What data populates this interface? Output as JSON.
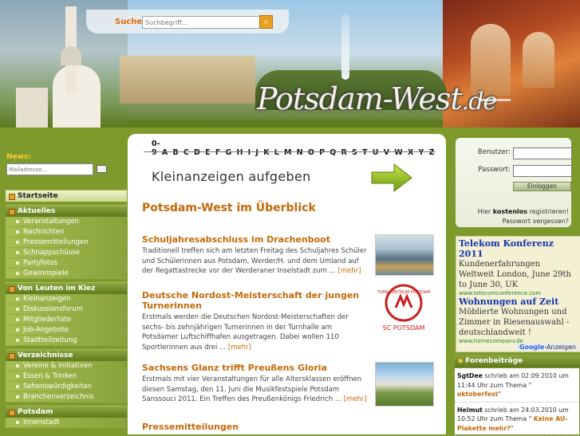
{
  "header": {
    "search_label": "Suche:",
    "search_placeholder": "Suchbegriff...",
    "search_button_icon": "magnifier-icon",
    "brand_main": "Potsdam-West",
    "brand_tld": ".de"
  },
  "sidebar": {
    "news_label": "News:",
    "mail_placeholder": "Mailadresse...",
    "mail_button_icon": "envelope-icon",
    "sections": [
      {
        "title": "Startseite",
        "active": true,
        "items": []
      },
      {
        "title": "Aktuelles",
        "items": [
          "Veranstaltungen",
          "Nachrichten",
          "Pressemitteilungen",
          "Schnappschüsse",
          "Partyfotos",
          "Gewinnspiele"
        ]
      },
      {
        "title": "Von Leuten im Kiez",
        "items": [
          "Kleinanzeigen",
          "Diskussionsforum",
          "Mitgliederliste",
          "Job-Angebote",
          "Stadtteilzeitung"
        ]
      },
      {
        "title": "Verzeichnisse",
        "items": [
          "Vereine & Initiativen",
          "Essen & Trinken",
          "Sehenswürdigkeiten",
          "Branchenverzeichnis"
        ]
      },
      {
        "title": "Potsdam",
        "items": [
          "Innenstadt"
        ]
      }
    ]
  },
  "main": {
    "alphabet": [
      "0-9",
      "A",
      "B",
      "C",
      "D",
      "E",
      "F",
      "G",
      "H",
      "I",
      "J",
      "K",
      "L",
      "M",
      "N",
      "O",
      "P",
      "Q",
      "R",
      "S",
      "T",
      "U",
      "V",
      "W",
      "X",
      "Y",
      "Z"
    ],
    "ad_banner": "Kleinanzeigen aufgeben",
    "page_title": "Potsdam-West im Überblick",
    "articles": [
      {
        "title": "Schuljahresabschluss im Drachenboot",
        "text": "Traditionell treffen sich am letzten Freitag des Schuljahres Schüler und Schülerinnen aus Potsdam, Werder/H. und dem Umland auf der Regattastrecke vor der Werderaner Inselstadt zum ...",
        "more": "[mehr]"
      },
      {
        "title": "Deutsche Nordost-Meisterschaft der jungen Turnerinnen",
        "text": "Erstmals werden die Deutschen Nordost-Meisterschaften der sechs- bis zehnjährigen Turnerinnen in der Turnhalle am Potsdamer Luftschiffhafen ausgetragen. Dabei wollen 110 Sportlerinnen aus drei ...",
        "more": "[mehr]"
      },
      {
        "title": "Sachsens Glanz trifft Preußens Gloria",
        "text": "Erstmals mit vier Veranstaltungen für alle Altersklassen eröffnen diesen Samstag, den 11. Juni die Musikfestspiele Potsdam Sanssouci 2011. Ein Treffen des Preußenkönigs Friedrich ...",
        "more": "[mehr]"
      },
      {
        "title": "Pressemitteilungen",
        "text": "",
        "more": ""
      }
    ],
    "logo_text_top": "TURN-ZENTRUM POTSDAM",
    "logo_text_bottom": "SC POTSDAM"
  },
  "login": {
    "user_label": "Benutzer:",
    "password_label": "Passwort:",
    "button": "Einloggen",
    "register_pre": "Hier ",
    "register_bold": "kostenlos",
    "register_post": " registrieren! Passwort vergessen?"
  },
  "ads": {
    "items": [
      {
        "title": "Telekom Konferenz 2011",
        "body": "Kundenerfahrungen Weltweit London, June 29th to June 30, UK",
        "url": "www.telecomconference.com"
      },
      {
        "title": "Wohnungen auf Zeit",
        "body": "Möblierte Wohnungen und Zimmer in Riesenauswahl - deutschlandweit !",
        "url": "www.homecompany.de"
      }
    ],
    "footer_brand": "Google",
    "footer_label": "-Anzeigen"
  },
  "forum": {
    "title": "Forenbeiträge",
    "entries": [
      {
        "user": "SgtDee",
        "text": " schrieb am 02.09.2010 um 11:44 Uhr zum Thema \" ",
        "topic": "oktoberfest",
        "end": "\""
      },
      {
        "user": "Helmut",
        "text": " schrieb am 24.03.2010 um 10:52 Uhr zum Thema \" ",
        "topic": "Keine AU-Plakette mehr?",
        "end": "\""
      }
    ]
  }
}
